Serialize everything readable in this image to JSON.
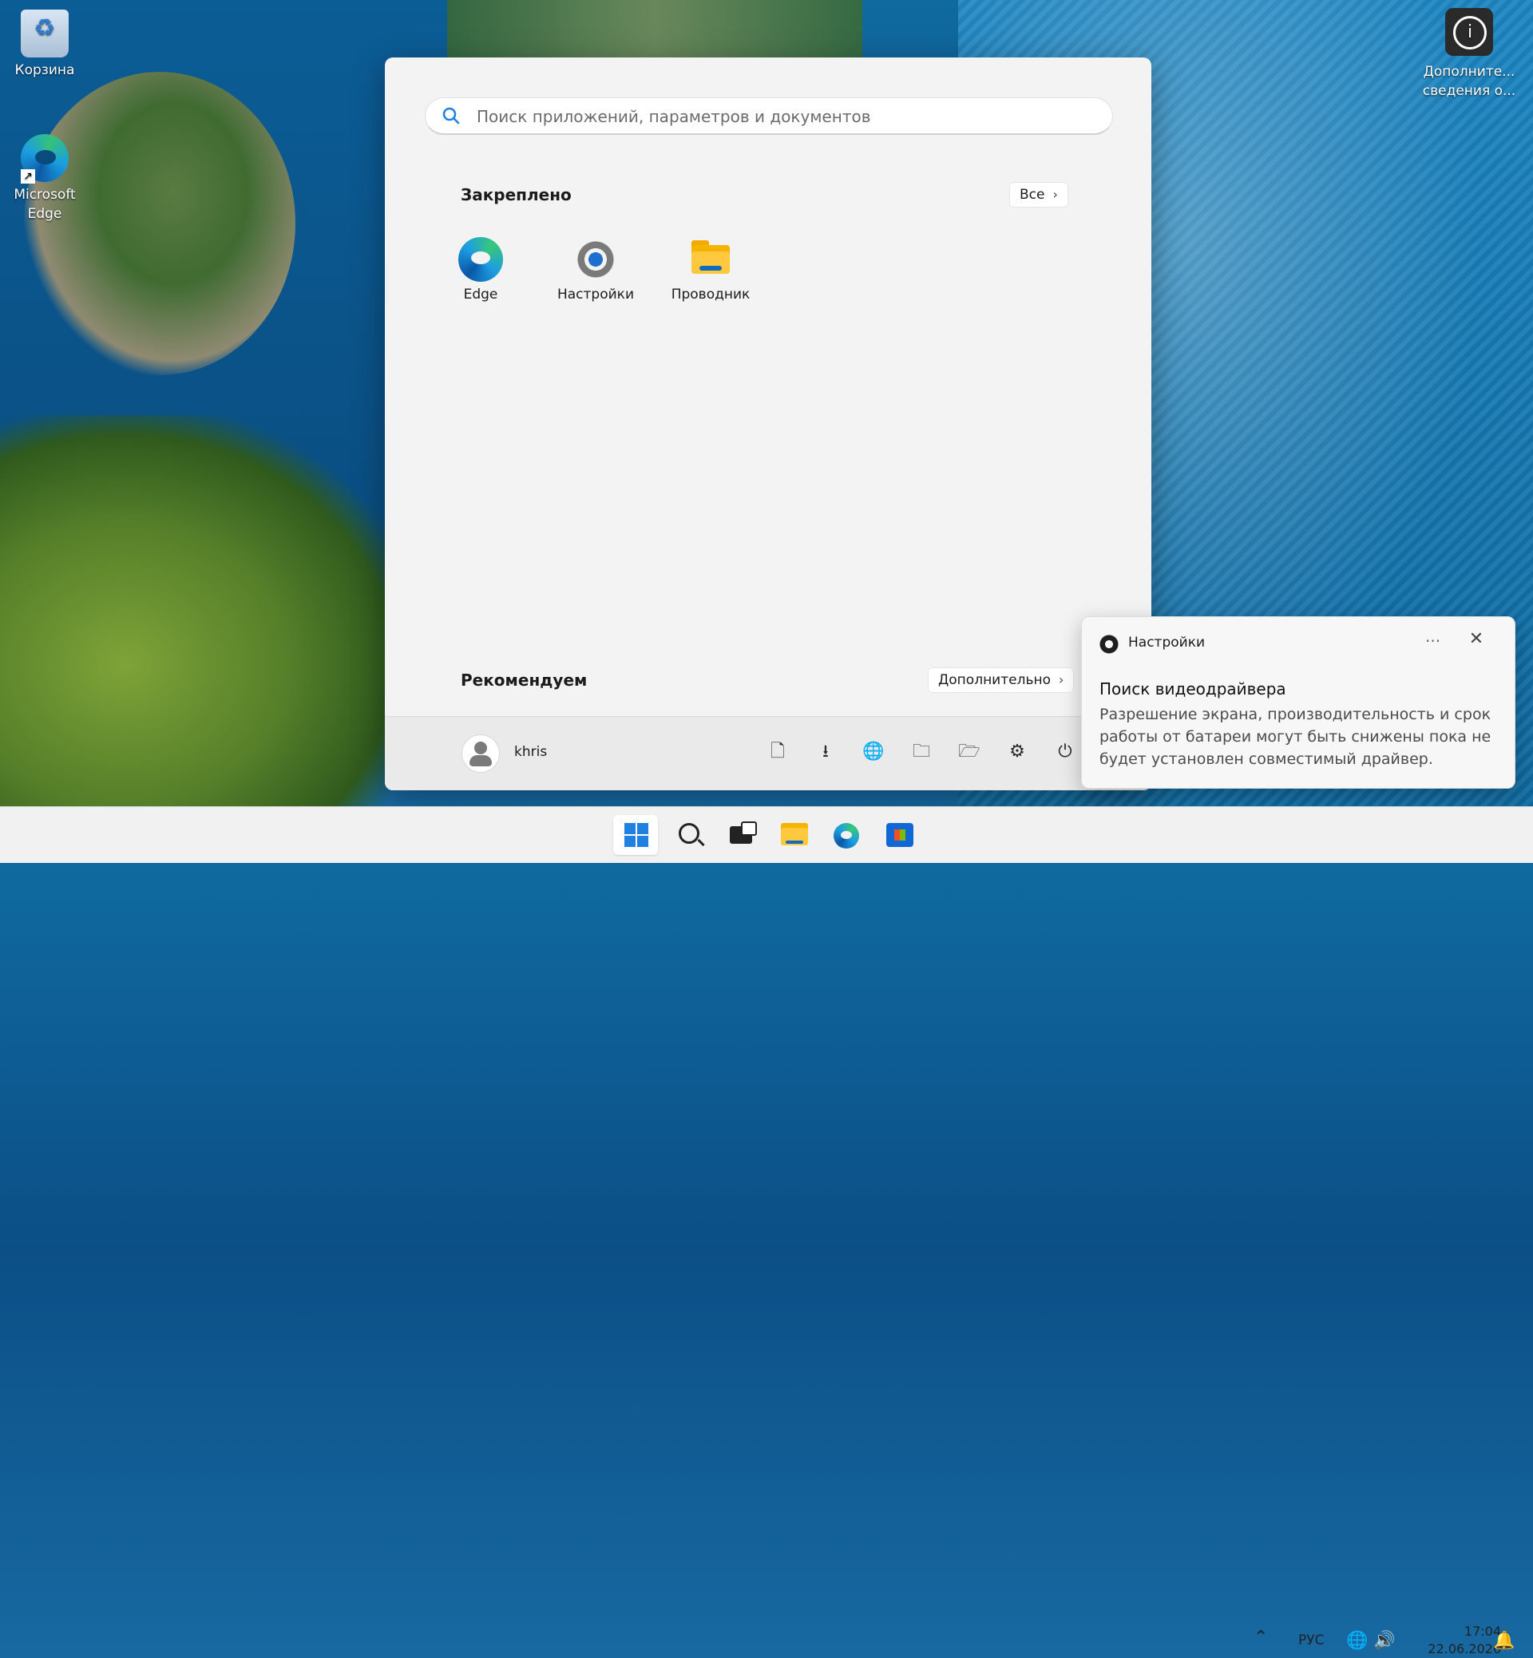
{
  "desktop": {
    "icons": [
      {
        "label": "Корзина",
        "icon": "recycle-bin-icon"
      },
      {
        "label": "Microsoft Edge",
        "icon": "edge-icon"
      }
    ],
    "top_right_item": {
      "label_line1": "Дополните...",
      "label_line2": "сведения о...",
      "icon": "info-badge-icon"
    }
  },
  "start_menu": {
    "search_placeholder": "Поиск приложений, параметров и документов",
    "pinned": {
      "title": "Закреплено",
      "all_button": "Все",
      "apps": [
        {
          "label": "Edge",
          "icon": "edge-icon"
        },
        {
          "label": "Настройки",
          "icon": "settings-gear-icon"
        },
        {
          "label": "Проводник",
          "icon": "file-explorer-icon"
        }
      ]
    },
    "recommended": {
      "title": "Рекомендуем",
      "more_button": "Дополнительно"
    },
    "footer": {
      "user_name": "khris",
      "icons": [
        "documents-icon",
        "downloads-icon",
        "network-icon",
        "user-folder-icon",
        "file-explorer-icon",
        "settings-icon",
        "power-icon"
      ]
    }
  },
  "toast": {
    "app_name": "Настройки",
    "title": "Поиск видеодрайвера",
    "body": "Разрешение экрана, производительность и срок работы от батареи могут быть снижены пока не будет установлен совместимый драйвер."
  },
  "taskbar": {
    "items": [
      "start-icon",
      "search-icon",
      "task-view-icon",
      "file-explorer-icon",
      "edge-icon",
      "store-icon"
    ],
    "tray": {
      "language": "РУС",
      "time": "17:04",
      "date": "22.06.2026"
    }
  },
  "colors": {
    "accent": "#1f80e0",
    "start_bg": "#f3f3f3",
    "taskbar_bg": "#f1f1f1"
  }
}
